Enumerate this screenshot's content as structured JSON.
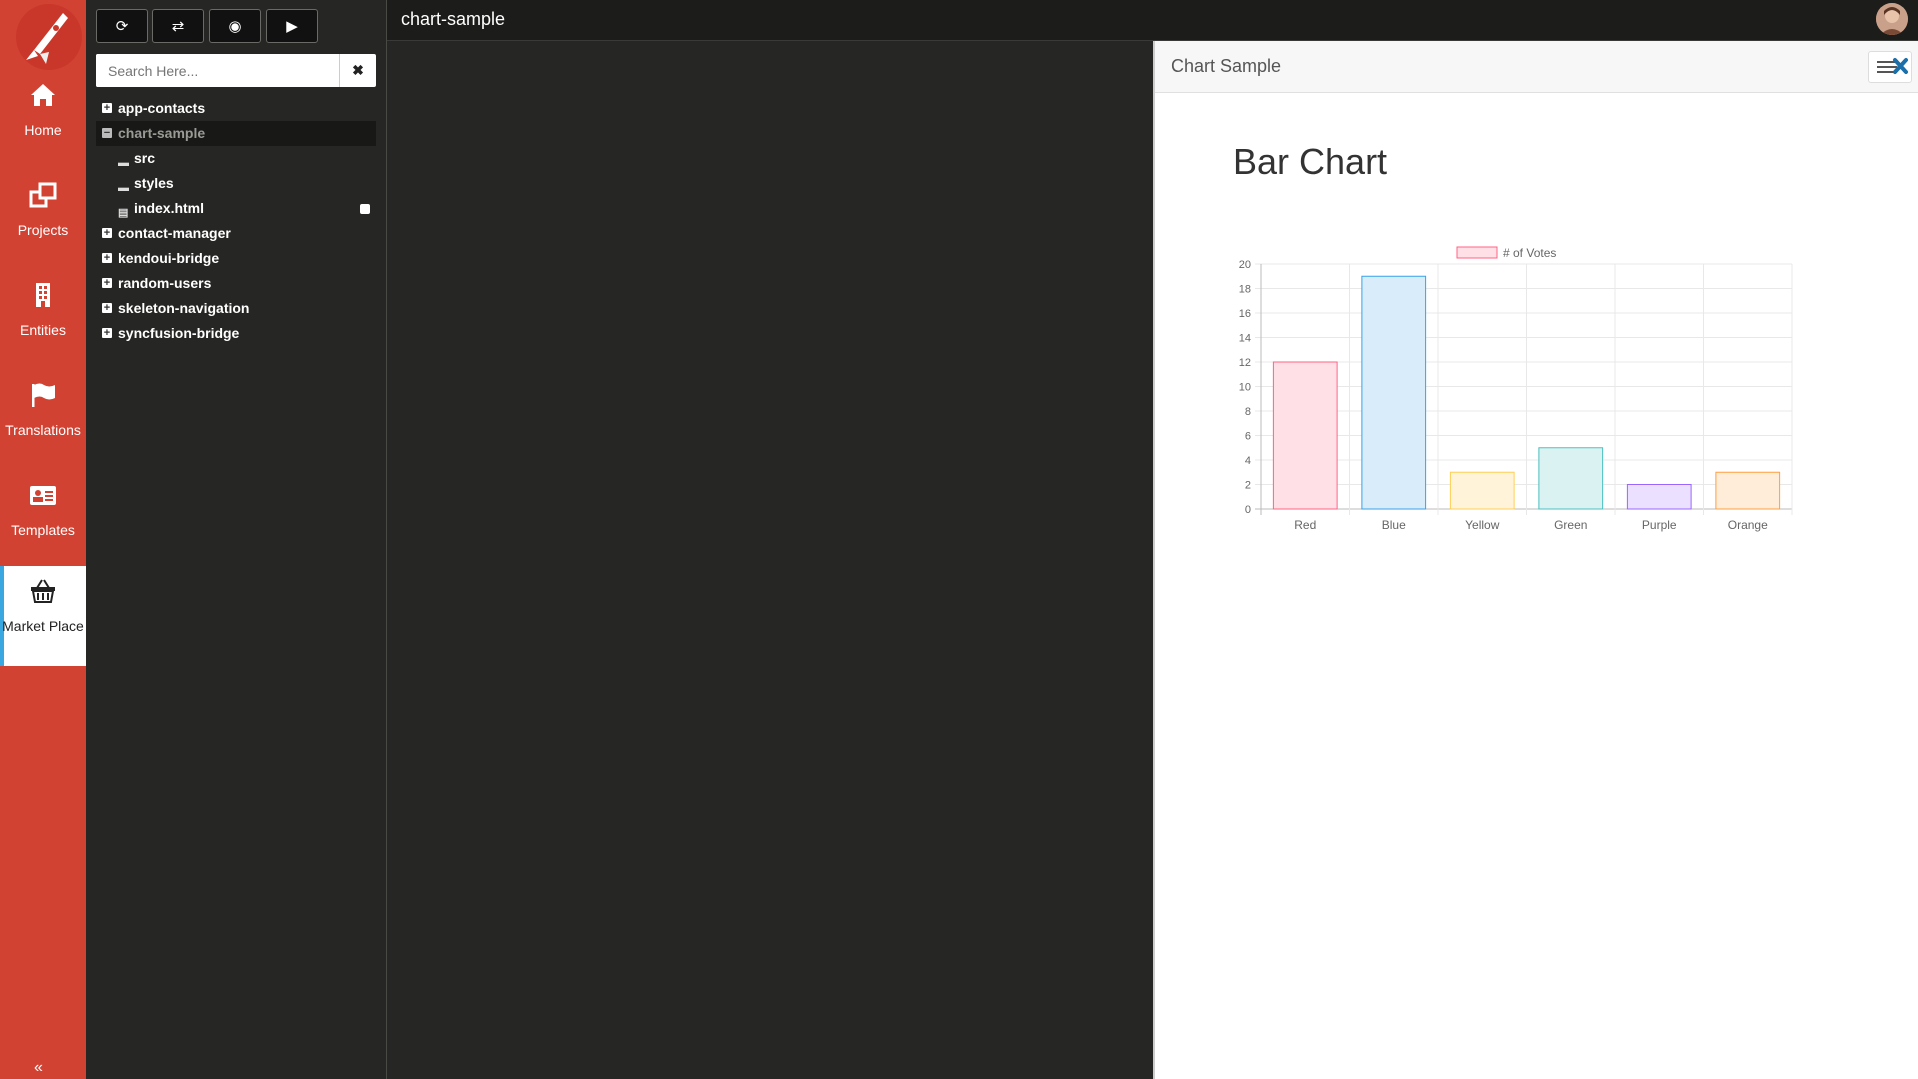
{
  "app": {
    "project_title": "chart-sample"
  },
  "nav": [
    {
      "label": "Home",
      "icon": "home-icon"
    },
    {
      "label": "Projects",
      "icon": "projects-icon"
    },
    {
      "label": "Entities",
      "icon": "building-icon"
    },
    {
      "label": "Translations",
      "icon": "flag-icon"
    },
    {
      "label": "Templates",
      "icon": "id-card-icon"
    },
    {
      "label": "Market Place",
      "icon": "basket-icon",
      "active": true
    }
  ],
  "toolbar": {
    "refresh_icon": "refresh-icon",
    "sync_icon": "retweet-icon",
    "preview_icon": "eye-icon",
    "run_icon": "play-icon"
  },
  "search": {
    "placeholder": "Search Here...",
    "value": ""
  },
  "tree": {
    "items": [
      {
        "label": "app-contacts",
        "level": 0,
        "expanded": false
      },
      {
        "label": "chart-sample",
        "level": 0,
        "expanded": true,
        "selected": true
      },
      {
        "label": "src",
        "level": 1,
        "type": "folder"
      },
      {
        "label": "styles",
        "level": 1,
        "type": "folder"
      },
      {
        "label": "index.html",
        "level": 1,
        "type": "file"
      },
      {
        "label": "contact-manager",
        "level": 0,
        "expanded": false
      },
      {
        "label": "kendoui-bridge",
        "level": 0,
        "expanded": false
      },
      {
        "label": "random-users",
        "level": 0,
        "expanded": false
      },
      {
        "label": "skeleton-navigation",
        "level": 0,
        "expanded": false
      },
      {
        "label": "syncfusion-bridge",
        "level": 0,
        "expanded": false
      }
    ]
  },
  "preview": {
    "title": "Chart Sample",
    "heading": "Bar Chart"
  },
  "chart_data": {
    "type": "bar",
    "categories": [
      "Red",
      "Blue",
      "Yellow",
      "Green",
      "Purple",
      "Orange"
    ],
    "series": [
      {
        "name": "# of Votes",
        "values": [
          12,
          19,
          3,
          5,
          2,
          3
        ]
      }
    ],
    "ylim": [
      0,
      20
    ],
    "yticks": [
      "0",
      "2",
      "4",
      "6",
      "8",
      "10",
      "12",
      "14",
      "16",
      "18",
      "20"
    ],
    "grid": true,
    "legend": "top",
    "fills": [
      "#ffe0e6",
      "#d8ecfa",
      "#fff4d9",
      "#dbf2f2",
      "#ebe0ff",
      "#ffecd9"
    ],
    "strokes": [
      "#ff6384",
      "#36a2eb",
      "#ffce56",
      "#4bc0c0",
      "#9966ff",
      "#ff9f40"
    ]
  },
  "colors": {
    "rail": "#d14233",
    "accent": "#3aa7e0",
    "panel": "#262724"
  }
}
